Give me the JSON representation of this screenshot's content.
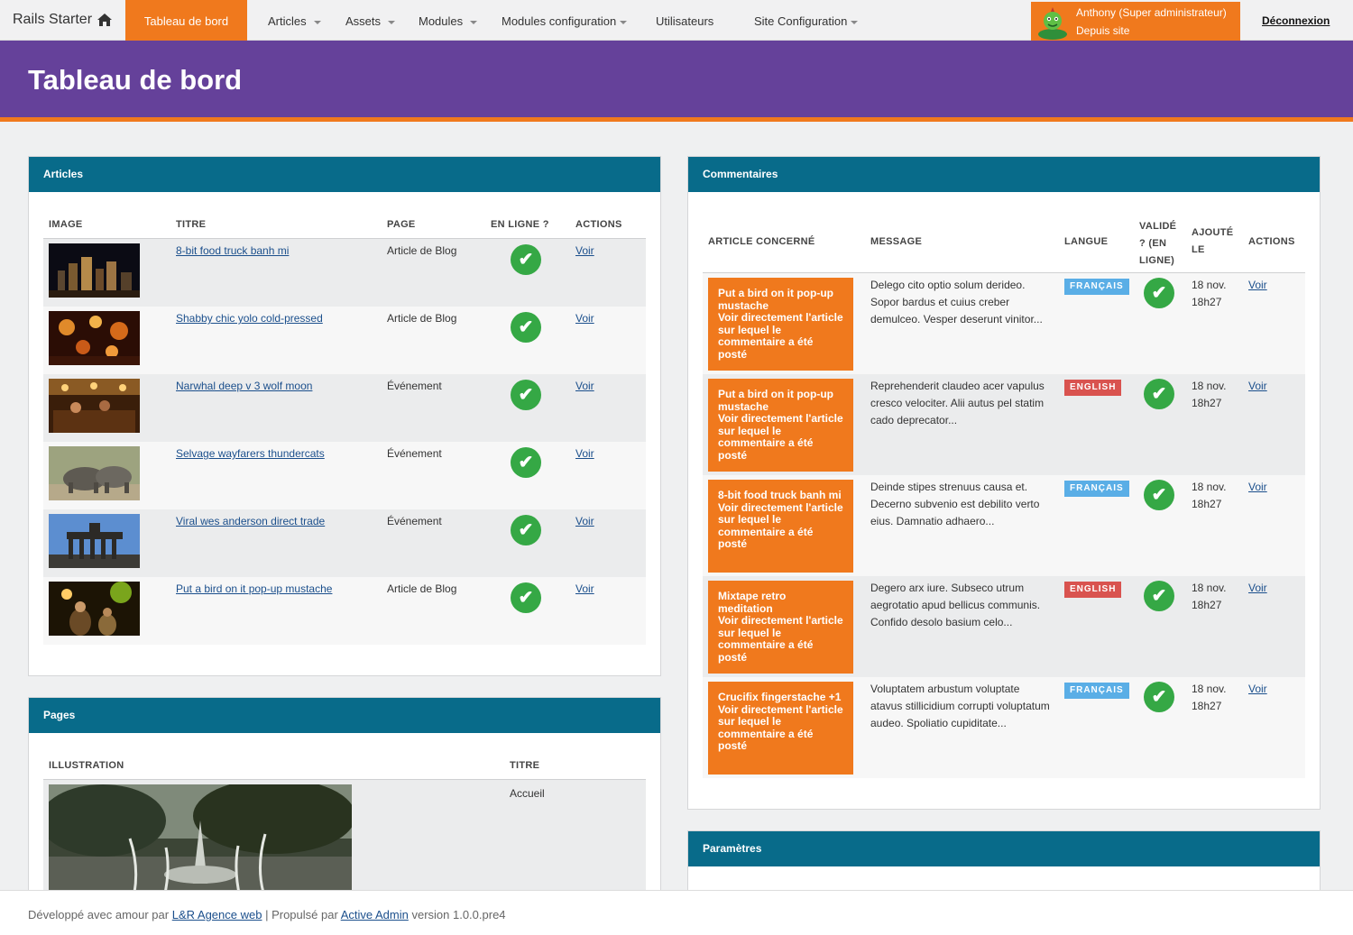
{
  "nav": {
    "brand": "Rails Starter",
    "items": [
      {
        "label": "Tableau de bord",
        "active": true,
        "caret": false
      },
      {
        "label": "Articles",
        "caret": true
      },
      {
        "label": "Assets",
        "caret": true
      },
      {
        "label": "Modules",
        "caret": true
      },
      {
        "label": "Modules configuration",
        "caret": true
      },
      {
        "label": "Utilisateurs",
        "caret": false
      },
      {
        "label": "Site Configuration",
        "caret": true
      }
    ],
    "user_name": "Anthony (Super administrateur)",
    "user_sub": "Depuis site",
    "logout": "Déconnexion"
  },
  "header": {
    "title": "Tableau de bord"
  },
  "articles": {
    "title": "Articles",
    "columns": {
      "image": "Image",
      "title": "Titre",
      "page": "Page",
      "online": "En ligne ?",
      "actions": "Actions"
    },
    "rows": [
      {
        "title": "8-bit food truck banh mi",
        "page": "Article de Blog",
        "action": "Voir",
        "thumb": "night-city"
      },
      {
        "title": "Shabby chic yolo cold-pressed",
        "page": "Article de Blog",
        "action": "Voir",
        "thumb": "lanterns"
      },
      {
        "title": "Narwhal deep v 3 wolf moon",
        "page": "Événement",
        "action": "Voir",
        "thumb": "bar"
      },
      {
        "title": "Selvage wayfarers thundercats",
        "page": "Événement",
        "action": "Voir",
        "thumb": "rhinos"
      },
      {
        "title": "Viral wes anderson direct trade",
        "page": "Événement",
        "action": "Voir",
        "thumb": "gate"
      },
      {
        "title": "Put a bird on it pop-up mustache",
        "page": "Article de Blog",
        "action": "Voir",
        "thumb": "concert"
      }
    ]
  },
  "pages": {
    "title": "Pages",
    "columns": {
      "illustration": "Illustration",
      "title": "Titre"
    },
    "rows": [
      {
        "title": "Accueil"
      }
    ]
  },
  "comments": {
    "title": "Commentaires",
    "columns": {
      "article": "Article concerné",
      "message": "Message",
      "lang": "Langue",
      "validated": "Validé ? (en ligne)",
      "added": "Ajouté le",
      "actions": "Actions"
    },
    "rows": [
      {
        "article": "Put a bird on it pop-up mustache",
        "link_text": "Voir directement l'article sur lequel le commentaire a été posté",
        "message": "Delego cito optio solum derideo. Sopor bardus et cuius creber demulceo. Vesper deserunt vinitor...",
        "lang": "FRANÇAIS",
        "lang_color": "#5aaee6",
        "date": "18 nov.",
        "time": "18h27",
        "action": "Voir"
      },
      {
        "article": "Put a bird on it pop-up mustache",
        "link_text": "Voir directement l'article sur lequel le commentaire a été posté",
        "message": "Reprehenderit claudeo acer vapulus cresco velociter. Alii autus pel statim cado deprecator...",
        "lang": "ENGLISH",
        "lang_color": "#d9534f",
        "date": "18 nov.",
        "time": "18h27",
        "action": "Voir"
      },
      {
        "article": "8-bit food truck banh mi",
        "link_text": "Voir directement l'article sur lequel le commentaire a été posté",
        "message": "Deinde stipes strenuus causa et. Decerno subvenio est debilito verto eius. Damnatio adhaero...",
        "lang": "FRANÇAIS",
        "lang_color": "#5aaee6",
        "date": "18 nov.",
        "time": "18h27",
        "action": "Voir"
      },
      {
        "article": "Mixtape retro meditation",
        "link_text": "Voir directement l'article sur lequel le commentaire a été posté",
        "message": "Degero arx iure. Subseco utrum aegrotatio apud bellicus communis. Confido desolo basium celo...",
        "lang": "ENGLISH",
        "lang_color": "#d9534f",
        "date": "18 nov.",
        "time": "18h27",
        "action": "Voir"
      },
      {
        "article": "Crucifix fingerstache +1",
        "link_text": "Voir directement l'article sur lequel le commentaire a été posté",
        "message": "Voluptatem arbustum voluptate atavus stillicidium corrupti voluptatum audeo. Spoliatio cupiditate...",
        "lang": "FRANÇAIS",
        "lang_color": "#5aaee6",
        "date": "18 nov.",
        "time": "18h27",
        "action": "Voir"
      }
    ]
  },
  "params": {
    "title": "Paramètres"
  },
  "footer": {
    "prefix": "Développé avec amour par",
    "agency": "L&R Agence web",
    "middle": "| Propulsé par",
    "engine": "Active Admin",
    "version": "version 1.0.0.pre4"
  },
  "colors": {
    "orange": "#f0791d",
    "purple": "#65419a",
    "teal": "#086b8a",
    "green": "#35a845"
  }
}
